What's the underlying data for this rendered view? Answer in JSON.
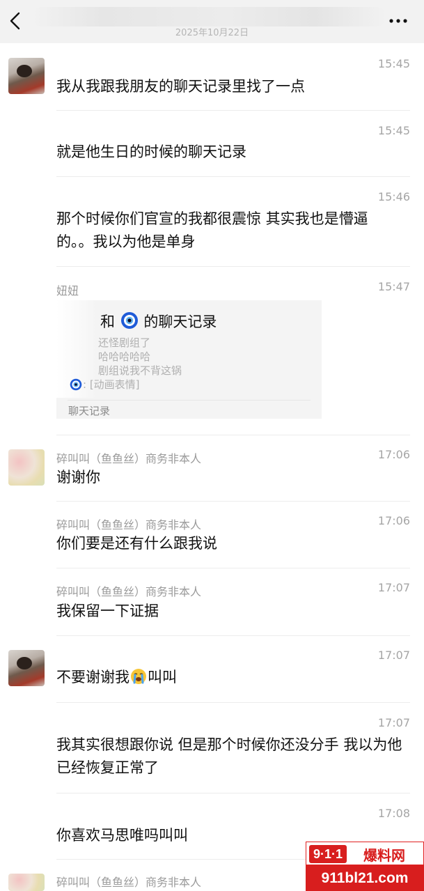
{
  "header": {
    "date": "2025年10月22日"
  },
  "messages": [
    {
      "time": "15:45",
      "text": "我从我跟我朋友的聊天记录里找了一点"
    },
    {
      "time": "15:45",
      "text": "就是他生日的时候的聊天记录"
    },
    {
      "time": "15:46",
      "text": "那个时候你们官宣的我都很震惊 其实我也是懵逼的。。我以为他是单身"
    },
    {
      "sender": "妞妞",
      "time": "15:47",
      "card": {
        "title_prefix": "和",
        "title_suffix": "的聊天记录",
        "lines": [
          "还怪剧组了",
          "哈哈哈哈哈",
          "剧组说我不背这锅",
          ": [动画表情]"
        ],
        "footer": "聊天记录"
      }
    },
    {
      "sender": "碎叫叫（鱼鱼丝）商务非本人",
      "time": "17:06",
      "text": "谢谢你"
    },
    {
      "sender": "碎叫叫（鱼鱼丝）商务非本人",
      "time": "17:06",
      "text": "你们要是还有什么跟我说"
    },
    {
      "sender": "碎叫叫（鱼鱼丝）商务非本人",
      "time": "17:07",
      "text": "我保留一下证据"
    },
    {
      "time": "17:07",
      "text_before": "不要谢谢我",
      "emoji": "crying-face",
      "text_after": "叫叫"
    },
    {
      "time": "17:07",
      "text": "我其实很想跟你说 但是那个时候你还没分手 我以为他已经恢复正常了"
    },
    {
      "time": "17:08",
      "text": "你喜欢马思唯吗叫叫"
    },
    {
      "sender": "碎叫叫（鱼鱼丝）商务非本人"
    }
  ],
  "watermark": {
    "logo": "9·1·1",
    "name": "爆料网",
    "url": "911bl21.com"
  },
  "colors": {
    "header_bg": "#f2f2f2",
    "time": "#a5a5a5",
    "sender": "#9a9a9a",
    "card_bg": "#f4f4f4",
    "eye_blue": "#1f5bd8",
    "watermark_red": "#d81e1e"
  }
}
